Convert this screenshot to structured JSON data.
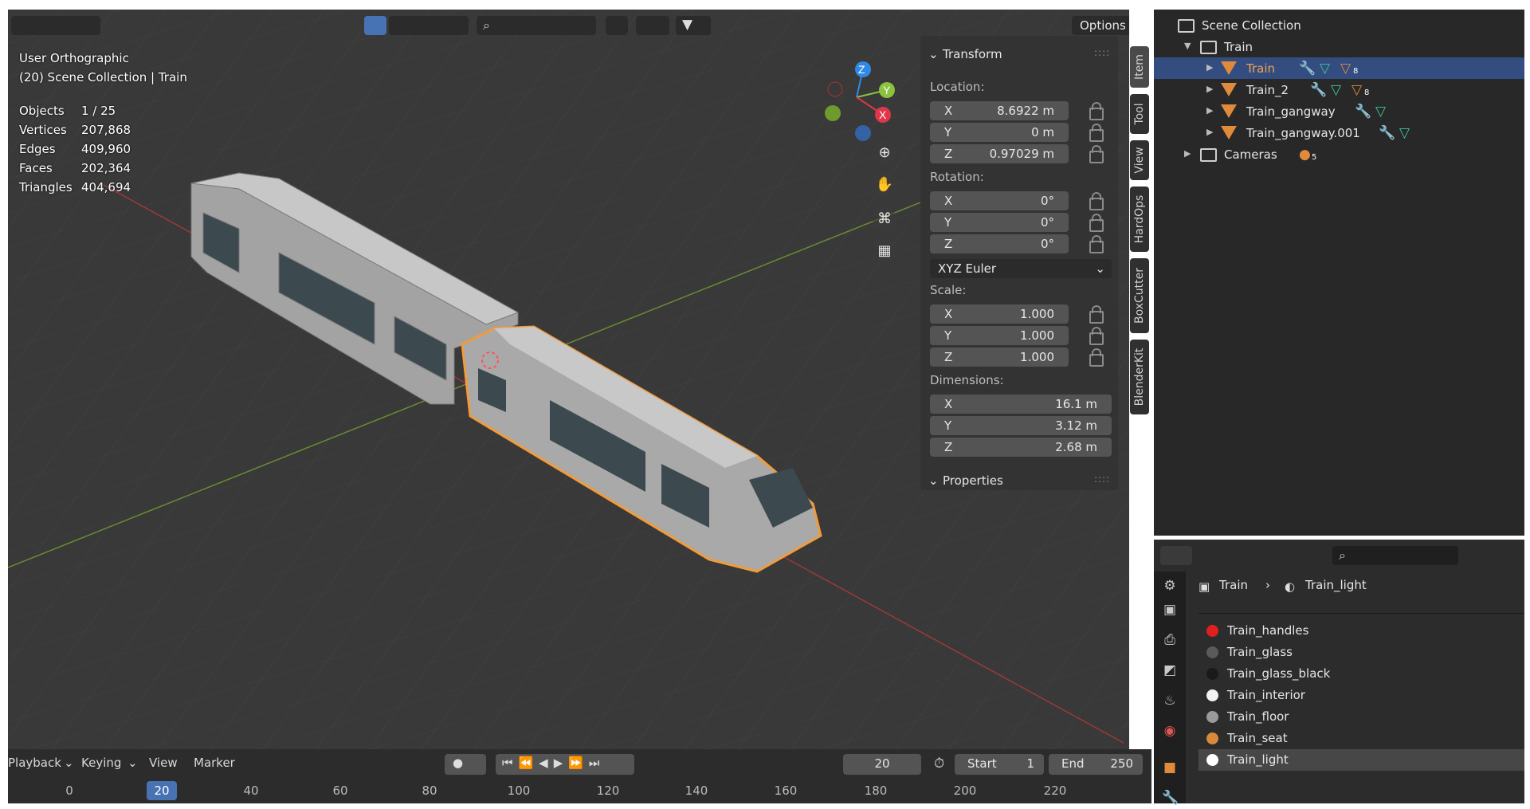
{
  "viewport": {
    "view_name": "User Orthographic",
    "scene_line": "(20) Scene Collection | Train",
    "stats": [
      {
        "label": "Objects",
        "value": "1 / 25"
      },
      {
        "label": "Vertices",
        "value": "207,868"
      },
      {
        "label": "Edges",
        "value": "409,960"
      },
      {
        "label": "Faces",
        "value": "202,364"
      },
      {
        "label": "Triangles",
        "value": "404,694"
      }
    ],
    "options_label": "Options",
    "gizmo": {
      "z": "Z",
      "y": "Y",
      "x": "X"
    }
  },
  "npanel": {
    "transform_title": "Transform",
    "location_label": "Location:",
    "location": [
      {
        "axis": "X",
        "value": "8.6922 m"
      },
      {
        "axis": "Y",
        "value": "0 m"
      },
      {
        "axis": "Z",
        "value": "0.97029 m"
      }
    ],
    "rotation_label": "Rotation:",
    "rotation": [
      {
        "axis": "X",
        "value": "0°"
      },
      {
        "axis": "Y",
        "value": "0°"
      },
      {
        "axis": "Z",
        "value": "0°"
      }
    ],
    "rotation_mode": "XYZ Euler",
    "scale_label": "Scale:",
    "scale": [
      {
        "axis": "X",
        "value": "1.000"
      },
      {
        "axis": "Y",
        "value": "1.000"
      },
      {
        "axis": "Z",
        "value": "1.000"
      }
    ],
    "dimensions_label": "Dimensions:",
    "dimensions": [
      {
        "axis": "X",
        "value": "16.1 m"
      },
      {
        "axis": "Y",
        "value": "3.12 m"
      },
      {
        "axis": "Z",
        "value": "2.68 m"
      }
    ],
    "properties_title": "Properties"
  },
  "side_tabs": [
    "Item",
    "Tool",
    "View",
    "HardOps",
    "BoxCutter",
    "BlenderKit"
  ],
  "timeline": {
    "menus": [
      "Playback",
      "Keying",
      "View",
      "Marker"
    ],
    "current_frame": "20",
    "start_label": "Start",
    "start_value": "1",
    "end_label": "End",
    "end_value": "250",
    "ruler": [
      "0",
      "20",
      "40",
      "60",
      "80",
      "100",
      "120",
      "140",
      "160",
      "180",
      "200",
      "220"
    ]
  },
  "outliner": {
    "root": "Scene Collection",
    "collection": "Train",
    "objects": [
      "Train",
      "Train_2",
      "Train_gangway",
      "Train_gangway.001"
    ],
    "cameras": "Cameras",
    "badges": {
      "train": "8",
      "train_2": "8",
      "cameras": "5"
    }
  },
  "properties": {
    "breadcrumb_object": "Train",
    "breadcrumb_material": "Train_light",
    "materials": [
      {
        "name": "Train_handles",
        "color": "#e02020"
      },
      {
        "name": "Train_glass",
        "color": "#5a5a5a"
      },
      {
        "name": "Train_glass_black",
        "color": "#1a1a1a"
      },
      {
        "name": "Train_interior",
        "color": "#f2f2f2"
      },
      {
        "name": "Train_floor",
        "color": "#9a9a9a"
      },
      {
        "name": "Train_seat",
        "color": "#d88a3a"
      },
      {
        "name": "Train_light",
        "color": "#ffffff"
      }
    ]
  },
  "colors": {
    "selection": "#f29b3c",
    "accent": "#4772b3"
  }
}
